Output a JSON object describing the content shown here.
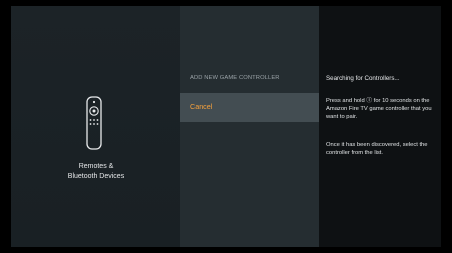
{
  "category": {
    "label_line1": "Remotes &",
    "label_line2": "Bluetooth Devices",
    "icon": "remote-control-icon"
  },
  "menu": {
    "header": "ADD NEW GAME CONTROLLER",
    "items": [
      {
        "label": "Cancel",
        "selected": true
      }
    ]
  },
  "help": {
    "status": "Searching for Controllers...",
    "instruction_part1": "Press and hold ",
    "instruction_icon": "circled-home-icon",
    "instruction_glyph": "Ⓘ",
    "instruction_part2": " for 10 seconds on the Amazon Fire TV game controller that you want to pair.",
    "discovery_note": "Once it has been discovered, select the controller from the list."
  },
  "colors": {
    "accent": "#f6a13c",
    "selected_row": "#434d52"
  }
}
